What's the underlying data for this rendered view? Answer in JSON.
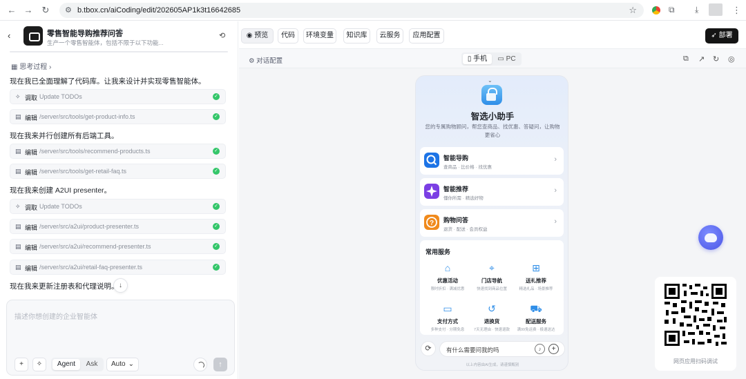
{
  "browser": {
    "url": "b.tbox.cn/aiCoding/edit/202605AP1k3t16642685"
  },
  "app": {
    "title": "零售智能导购推荐问答",
    "subtitle": "生产一个零售智能体，包括不限于以下功能..."
  },
  "chat": {
    "thinking_label": "思考过程",
    "messages": [
      "现在我已全面理解了代码库。让我来设计并实现零售智能体。",
      "现在我来并行创建所有后端工具。",
      "现在我来创建 A2UI presenter。",
      "现在我来更新注册表和代理说明。"
    ],
    "tools": [
      {
        "verb": "调取",
        "path": "Update TODOs"
      },
      {
        "verb": "编辑",
        "path": "/server/src/tools/get-product-info.ts"
      },
      {
        "verb": "编辑",
        "path": "/server/src/tools/recommend-products.ts"
      },
      {
        "verb": "编辑",
        "path": "/server/src/tools/get-retail-faq.ts"
      },
      {
        "verb": "调取",
        "path": "Update TODOs"
      },
      {
        "verb": "编辑",
        "path": "/server/src/a2ui/product-presenter.ts"
      },
      {
        "verb": "编辑",
        "path": "/server/src/a2ui/recommend-presenter.ts"
      },
      {
        "verb": "编辑",
        "path": "/server/src/a2ui/retail-faq-presenter.ts"
      }
    ]
  },
  "composer": {
    "placeholder": "描述你想创建的企业智能体",
    "mode_agent": "Agent",
    "mode_ask": "Ask",
    "model_select": "Auto"
  },
  "toolbar": {
    "tabs": [
      "预览",
      "代码",
      "环境变量",
      "知识库",
      "云服务",
      "应用配置"
    ],
    "deploy_label": "部署"
  },
  "preview": {
    "config_label": "对话配置",
    "device_mobile": "手机",
    "device_pc": "PC"
  },
  "phone": {
    "title": "智选小助手",
    "description": "您的专属购物顾问，帮您查商品、找优惠、答疑问，让购物更省心",
    "cards": [
      {
        "title": "智能导购",
        "sub": "查商品 · 比价格 · 找优惠",
        "color": "#1d74e6"
      },
      {
        "title": "智能推荐",
        "sub": "懂你所需 · 精选好物",
        "color": "#7b3fe4"
      },
      {
        "title": "购物问答",
        "sub": "退货 · 配送 · 会员权益",
        "color": "#f08a1c"
      }
    ],
    "services_title": "常用服务",
    "services": [
      {
        "name": "优惠活动",
        "desc": "限时折扣 · 满减优惠",
        "icon": "tag-icon"
      },
      {
        "name": "门店导航",
        "desc": "快速找到商品位置",
        "icon": "location-pin-icon"
      },
      {
        "name": "送礼推荐",
        "desc": "精选礼品 · 场景推荐",
        "icon": "gift-icon"
      },
      {
        "name": "支付方式",
        "desc": "多种支付 · 分期免息",
        "icon": "card-icon"
      },
      {
        "name": "退换货",
        "desc": "7天无理由 · 快速退款",
        "icon": "return-icon"
      },
      {
        "name": "配送服务",
        "desc": "满99免运费 · 极速送达",
        "icon": "truck-icon"
      }
    ],
    "input_text": "有什么需要问我的吗",
    "footer": "以上内容由AI生成，请谨慎甄别"
  },
  "qr": {
    "caption": "网页应用扫码调试"
  },
  "colors": {
    "accent_blue": "#2f8ee8",
    "success_green": "#34c66a",
    "deploy_black": "#141414"
  }
}
